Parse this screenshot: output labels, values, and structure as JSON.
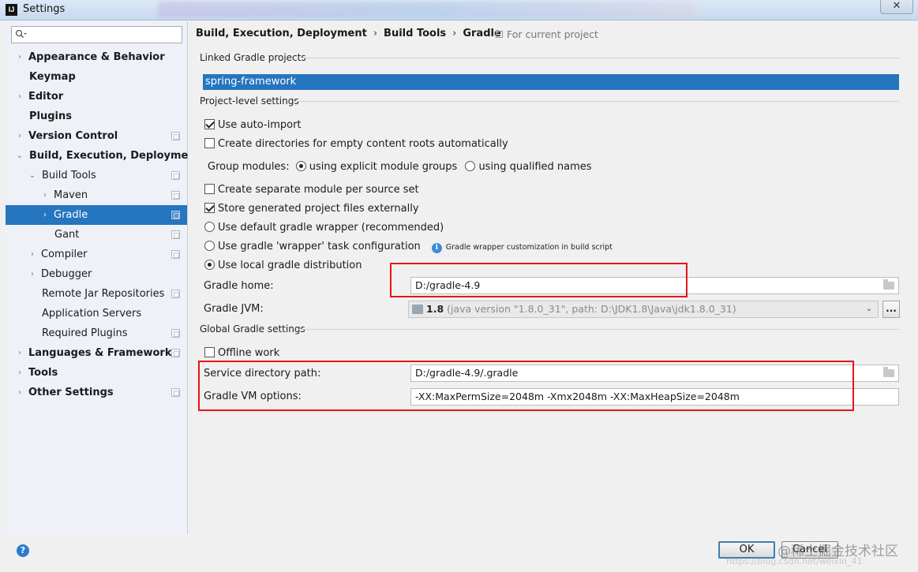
{
  "window": {
    "app_icon": "IJ",
    "title": "Settings",
    "close_glyph": "✕"
  },
  "sidebar": {
    "search_placeholder": "",
    "items": [
      {
        "label": "Appearance & Behavior",
        "arrow": "›"
      },
      {
        "label": "Keymap",
        "arrow": ""
      },
      {
        "label": "Editor",
        "arrow": "›"
      },
      {
        "label": "Plugins",
        "arrow": ""
      },
      {
        "label": "Version Control",
        "arrow": "›"
      },
      {
        "label": "Build, Execution, Deployment",
        "arrow": "⌄"
      },
      {
        "label": "Build Tools",
        "arrow": "⌄"
      },
      {
        "label": "Maven",
        "arrow": "›"
      },
      {
        "label": "Gradle",
        "arrow": "›"
      },
      {
        "label": "Gant",
        "arrow": ""
      },
      {
        "label": "Compiler",
        "arrow": "›"
      },
      {
        "label": "Debugger",
        "arrow": "›"
      },
      {
        "label": "Remote Jar Repositories",
        "arrow": ""
      },
      {
        "label": "Application Servers",
        "arrow": ""
      },
      {
        "label": "Required Plugins",
        "arrow": ""
      },
      {
        "label": "Languages & Frameworks",
        "arrow": "›"
      },
      {
        "label": "Tools",
        "arrow": "›"
      },
      {
        "label": "Other Settings",
        "arrow": "›"
      }
    ]
  },
  "breadcrumb": {
    "parts": [
      "Build, Execution, Deployment",
      "Build Tools",
      "Gradle"
    ],
    "separator": "›",
    "scope_note": "For current project"
  },
  "linked": {
    "section_label": "Linked Gradle projects",
    "projects": [
      "spring-framework"
    ]
  },
  "project_settings": {
    "section_label": "Project-level settings",
    "use_auto_import": "Use auto-import",
    "create_dirs": "Create directories for empty content roots automatically",
    "group_modules_label": "Group modules:",
    "group_explicit": "using explicit module groups",
    "group_qualified": "using qualified names",
    "separate_module": "Create separate module per source set",
    "store_external": "Store generated project files externally",
    "default_wrapper": "Use default gradle wrapper (recommended)",
    "wrapper_task": "Use gradle 'wrapper' task configuration",
    "wrapper_note": "Gradle wrapper customization in build script",
    "local_dist": "Use local gradle distribution",
    "gradle_home_label": "Gradle home:",
    "gradle_home_value": "D:/gradle-4.9",
    "gradle_jvm_label": "Gradle JVM:",
    "gradle_jvm_version": "1.8",
    "gradle_jvm_detail": "(java version \"1.8.0_31\", path: D:\\JDK1.8\\Java\\jdk1.8.0_31)",
    "browse_label": "..."
  },
  "global_settings": {
    "section_label": "Global Gradle settings",
    "offline_work": "Offline work",
    "service_dir_label": "Service directory path:",
    "service_dir_value": "D:/gradle-4.9/.gradle",
    "vm_options_label": "Gradle VM options:",
    "vm_options_value": "-XX:MaxPermSize=2048m -Xmx2048m -XX:MaxHeapSize=2048m"
  },
  "footer": {
    "help": "?",
    "ok": "OK",
    "cancel": "Cancel",
    "watermark": "@稀土掘金技术社区",
    "watermark_url": "https://blog.csdn.net/weixin_41"
  },
  "colors": {
    "selection": "#2675bf",
    "highlight_box": "#e8141b"
  }
}
